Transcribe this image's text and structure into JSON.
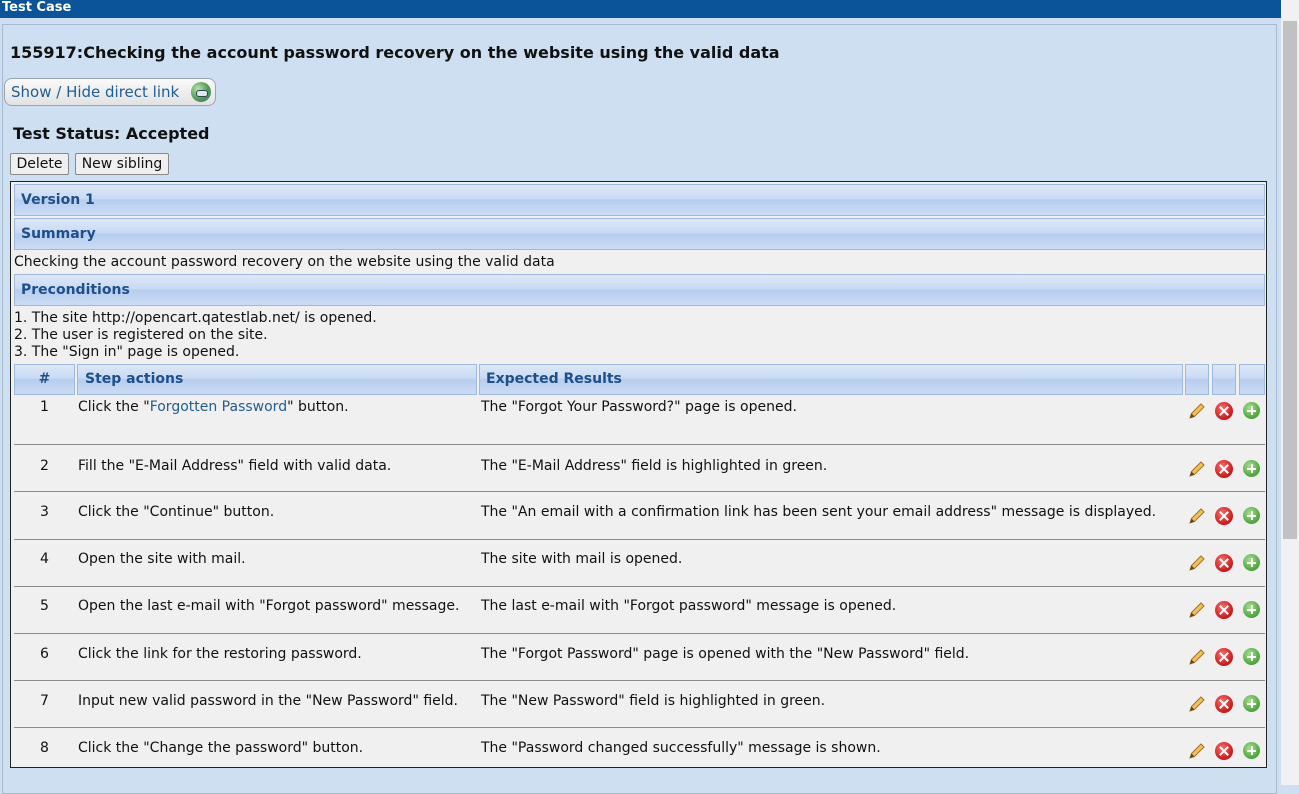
{
  "window": {
    "title": "Test Case"
  },
  "testcase": {
    "title": "155917:Checking the account password recovery on the website using the valid data",
    "direct_link_label": "Show / Hide direct link",
    "status_label": "Test Status: Accepted"
  },
  "actions": {
    "delete_label": "Delete",
    "new_sibling_label": "New sibling"
  },
  "version": {
    "label": "Version 1"
  },
  "summary": {
    "header": "Summary",
    "text": "Checking the account password recovery on the website using the valid data"
  },
  "preconditions": {
    "header": "Preconditions",
    "lines": [
      "1. The site http://opencart.qatestlab.net/ is opened.",
      "2. The user is registered on the site.",
      "3. The \"Sign in\" page is opened."
    ]
  },
  "steps": {
    "columns": {
      "num": "#",
      "actions": "Step actions",
      "results": "Expected Results"
    },
    "rows": [
      {
        "num": "1",
        "action_pre": "Click the \"",
        "action_link": "Forgotten Password",
        "action_post": "\" button.",
        "result": "The \"Forgot Your Password?\" page is opened."
      },
      {
        "num": "2",
        "action": "Fill the \"E-Mail Address\" field with valid data.",
        "result": "The \"E-Mail Address\" field is highlighted in green."
      },
      {
        "num": "3",
        "action": "Click the \"Continue\" button.",
        "result": "The \"An email with a confirmation link has been sent your email address\" message is displayed."
      },
      {
        "num": "4",
        "action": "Open the site with mail.",
        "result": "The site with mail is opened."
      },
      {
        "num": "5",
        "action": "Open the last e-mail with \"Forgot password\" message.",
        "result": "The last e-mail with \"Forgot password\" message is opened."
      },
      {
        "num": "6",
        "action": "Click the link for the restoring password.",
        "result": "The \"Forgot Password\" page is opened with the \"New Password\" field."
      },
      {
        "num": "7",
        "action": "Input new valid password in the \"New Password\" field.",
        "result": "The \"New Password\" field is  highlighted in green."
      },
      {
        "num": "8",
        "action": "Click the \"Change the password\" button.",
        "result": "The \"Password changed successfully\" message is shown."
      }
    ]
  },
  "icons": {
    "direct_link": "globe-link-icon",
    "edit": "pencil-icon",
    "delete": "delete-icon",
    "add": "add-icon"
  }
}
